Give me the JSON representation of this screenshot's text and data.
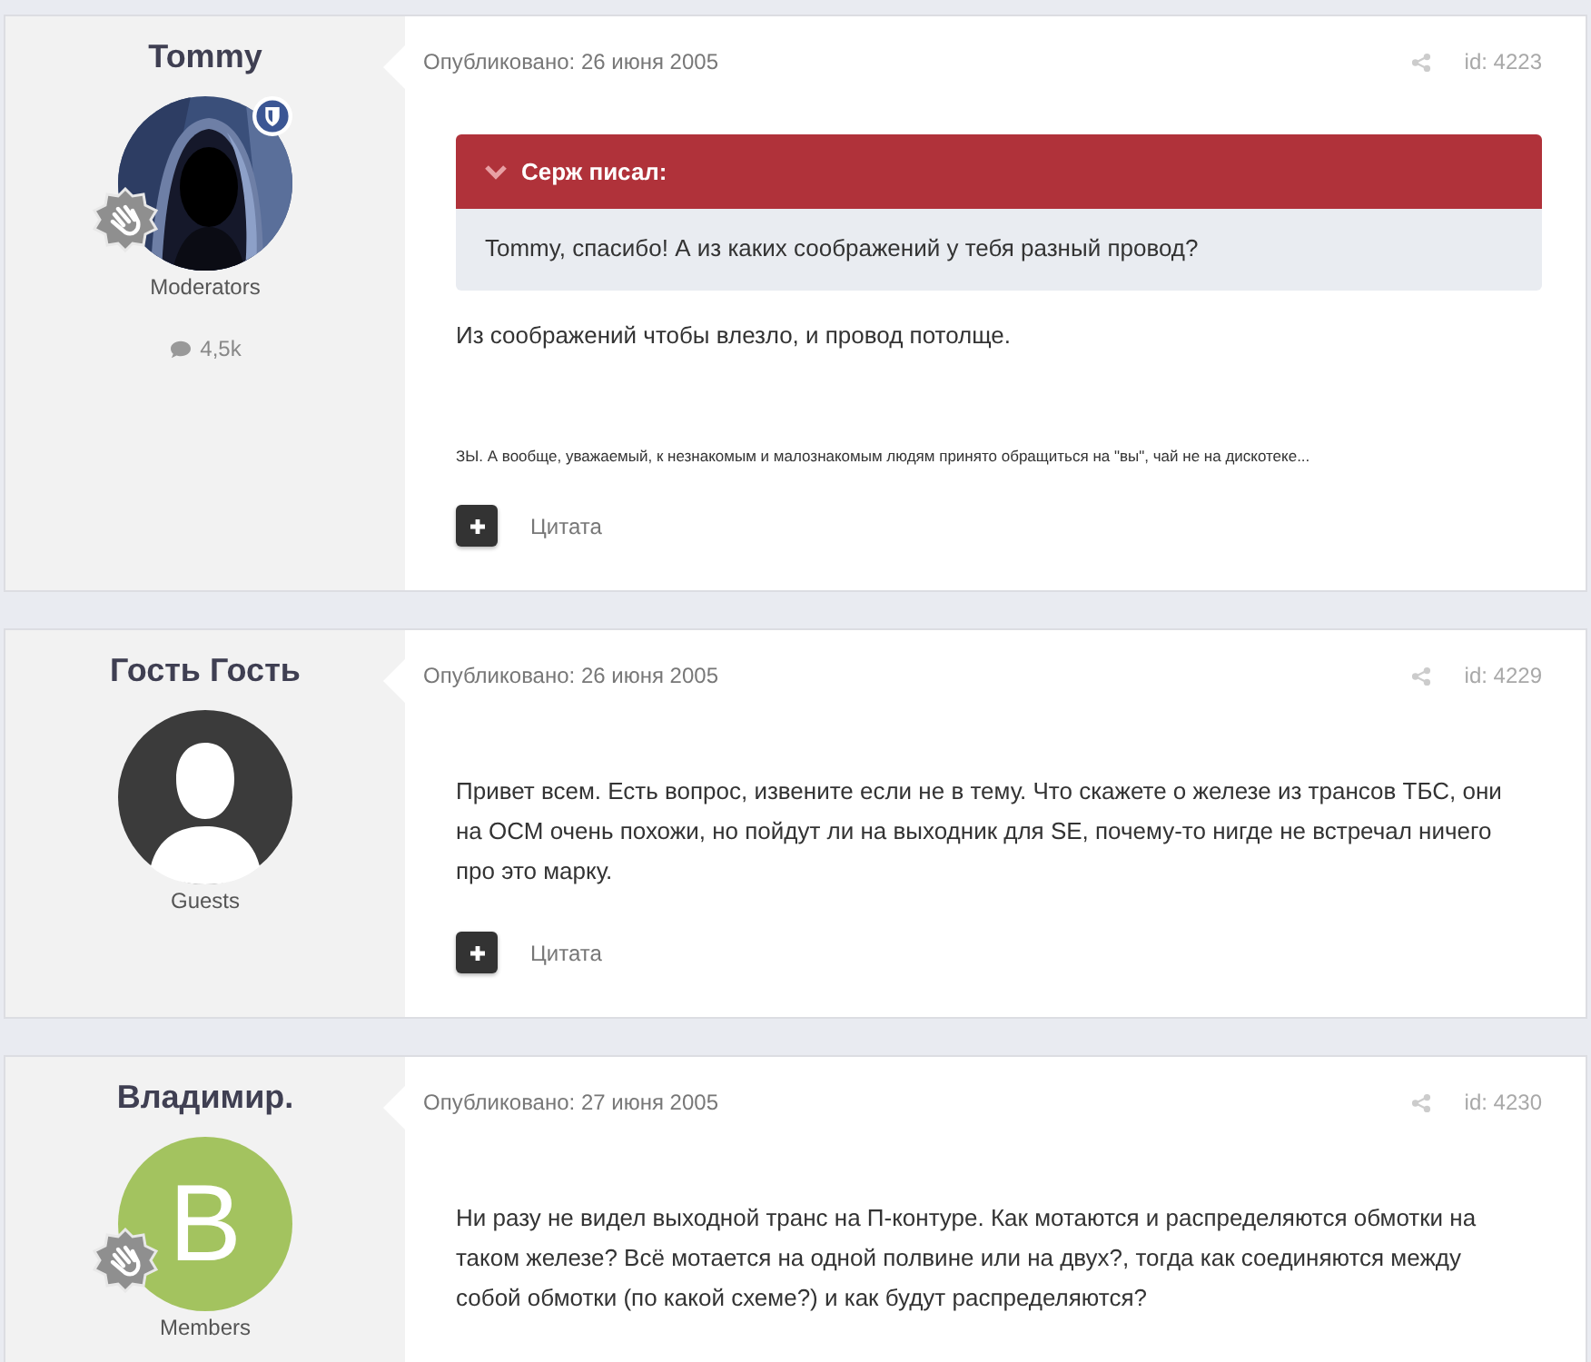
{
  "posts": [
    {
      "author": {
        "name": "Tommy",
        "rank": "Moderators",
        "moderator_badge": true,
        "rank_badge": true,
        "post_count": "4,5k"
      },
      "published": "Опубликовано: 26 июня 2005",
      "id": "id: 4223",
      "quote": {
        "author": "Серж писал:",
        "text": "Tommy, спасибо! А из каких соображений у тебя разный провод?"
      },
      "paragraphs": [
        {
          "kind": "text",
          "text": "Из соображений чтобы влезло, и провод потолще."
        },
        {
          "kind": "small",
          "text": "ЗЫ. А вообще, уважаемый, к незнакомым и малознакомым людям принято обращиться на \"вы\", чай не на дискотеке..."
        }
      ],
      "quote_button": "Цитата"
    },
    {
      "author": {
        "name": "Гость Гость",
        "rank": "Guests",
        "avatar": {
          "kind": "silhouette"
        },
        "moderator_badge": false,
        "rank_badge": false
      },
      "published": "Опубликовано: 26 июня 2005",
      "id": "id: 4229",
      "paragraphs": [
        {
          "kind": "text",
          "text": "Привет всем. Есть вопрос, извените если не в тему. Что скажете о железе из трансов ТБС, они на ОСМ очень похожи, но пойдут ли на выходник для SE, почему-то нигде не встречал ничего про это марку."
        }
      ],
      "quote_button": "Цитата"
    },
    {
      "author": {
        "name": "Владимир.",
        "rank": "Members",
        "avatar": {
          "kind": "letter",
          "letter": "В",
          "color": "#a3c35f"
        },
        "moderator_badge": false,
        "rank_badge": true
      },
      "published": "Опубликовано: 27 июня 2005",
      "id": "id: 4230",
      "paragraphs": [
        {
          "kind": "text",
          "text": "Ни разу не видел выходной транс на П-контуре. Как мотаются и распределяются обмотки на таком железе? Всё мотается на одной полвине или на двух?, тогда как соединяются между собой обмотки (по какой схеме?) и как будут распределяются?"
        }
      ]
    }
  ]
}
